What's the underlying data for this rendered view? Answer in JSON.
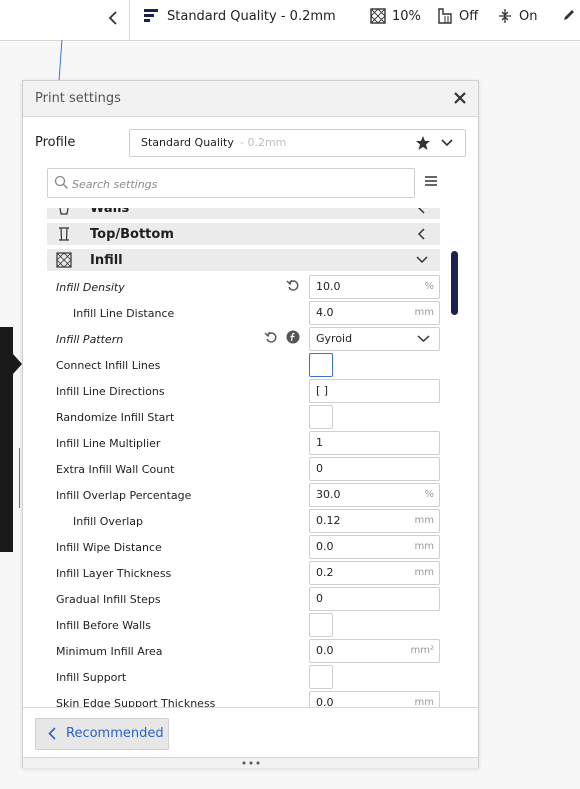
{
  "topbar": {
    "quality": "Standard Quality - 0.2mm",
    "infill": "10%",
    "support": "Off",
    "adhesion": "On"
  },
  "panel": {
    "title": "Print settings",
    "profile_label": "Profile",
    "profile_name": "Standard Quality",
    "profile_layer": " - 0.2mm",
    "search_placeholder": "Search settings",
    "recommended_label": "Recommended"
  },
  "categories": {
    "walls": "Walls",
    "topbottom": "Top/Bottom",
    "infill": "Infill"
  },
  "settings": [
    {
      "label": "Infill Density",
      "value": "10.0",
      "unit": "%"
    },
    {
      "label": "Infill Line Distance",
      "value": "4.0",
      "unit": "mm"
    },
    {
      "label": "Infill Pattern",
      "value": "Gyroid"
    },
    {
      "label": "Connect Infill Lines"
    },
    {
      "label": "Infill Line Directions",
      "value": "[ ]"
    },
    {
      "label": "Randomize Infill Start"
    },
    {
      "label": "Infill Line Multiplier",
      "value": "1"
    },
    {
      "label": "Extra Infill Wall Count",
      "value": "0"
    },
    {
      "label": "Infill Overlap Percentage",
      "value": "30.0",
      "unit": "%"
    },
    {
      "label": "Infill Overlap",
      "value": "0.12",
      "unit": "mm"
    },
    {
      "label": "Infill Wipe Distance",
      "value": "0.0",
      "unit": "mm"
    },
    {
      "label": "Infill Layer Thickness",
      "value": "0.2",
      "unit": "mm"
    },
    {
      "label": "Gradual Infill Steps",
      "value": "0"
    },
    {
      "label": "Infill Before Walls"
    },
    {
      "label": "Minimum Infill Area",
      "value": "0.0",
      "unit": "mm²"
    },
    {
      "label": "Infill Support"
    },
    {
      "label": "Skin Edge Support Thickness",
      "value": "0.0",
      "unit": "mm"
    }
  ],
  "icons": [
    "chevron-left-icon",
    "layers-icon",
    "infill-icon",
    "support-icon",
    "adhesion-icon",
    "pencil-icon",
    "close-icon",
    "star-icon",
    "chevron-down-icon",
    "search-icon",
    "menu-icon",
    "walls-icon",
    "topbottom-icon",
    "reset-icon",
    "function-icon"
  ],
  "colors": {
    "accent": "#2a62c8",
    "scrollbar": "#1b2252",
    "focus": "#3b6fd1"
  }
}
